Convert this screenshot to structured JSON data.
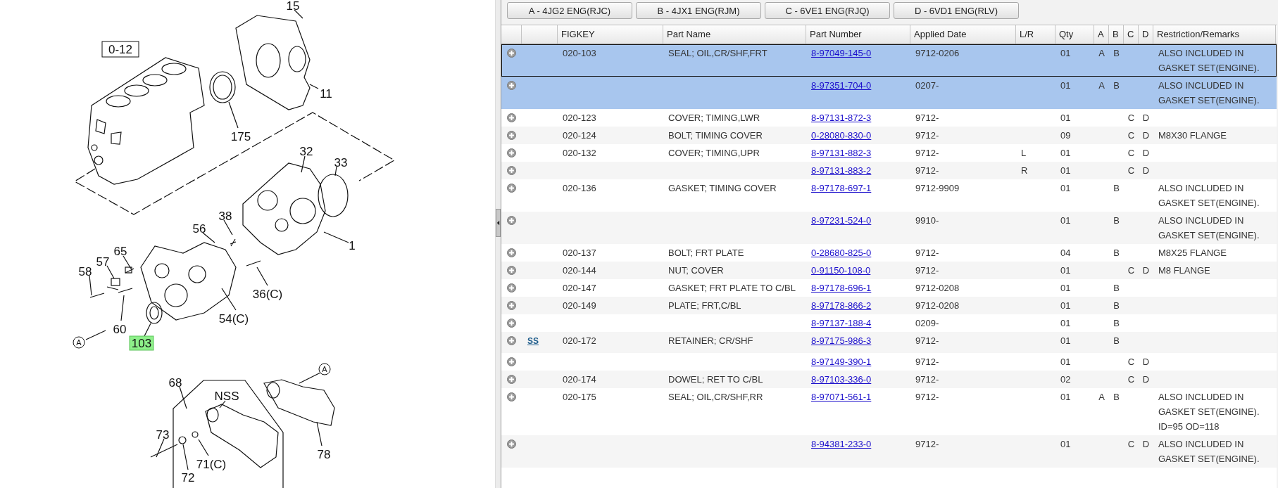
{
  "diagram": {
    "callouts": [
      {
        "text": "15",
        "kind": "plain",
        "highlighted": false
      },
      {
        "text": "0-12",
        "kind": "boxed",
        "highlighted": false
      },
      {
        "text": "11",
        "kind": "plain",
        "highlighted": false
      },
      {
        "text": "175",
        "kind": "plain",
        "highlighted": false
      },
      {
        "text": "32",
        "kind": "plain",
        "highlighted": false
      },
      {
        "text": "33",
        "kind": "plain",
        "highlighted": false
      },
      {
        "text": "38",
        "kind": "plain",
        "highlighted": false
      },
      {
        "text": "56",
        "kind": "plain",
        "highlighted": false
      },
      {
        "text": "1",
        "kind": "plain",
        "highlighted": false
      },
      {
        "text": "65",
        "kind": "plain",
        "highlighted": false
      },
      {
        "text": "57",
        "kind": "plain",
        "highlighted": false
      },
      {
        "text": "58",
        "kind": "plain",
        "highlighted": false
      },
      {
        "text": "36(C)",
        "kind": "plain",
        "highlighted": false
      },
      {
        "text": "54(C)",
        "kind": "plain",
        "highlighted": false
      },
      {
        "text": "60",
        "kind": "plain",
        "highlighted": false
      },
      {
        "text": "103",
        "kind": "plain",
        "highlighted": true
      },
      {
        "text": "A",
        "kind": "circled",
        "highlighted": false
      },
      {
        "text": "68",
        "kind": "plain",
        "highlighted": false
      },
      {
        "text": "NSS",
        "kind": "plain",
        "highlighted": false
      },
      {
        "text": "A",
        "kind": "circled",
        "highlighted": false
      },
      {
        "text": "73",
        "kind": "plain",
        "highlighted": false
      },
      {
        "text": "71(C)",
        "kind": "plain",
        "highlighted": false
      },
      {
        "text": "72",
        "kind": "plain",
        "highlighted": false
      },
      {
        "text": "78",
        "kind": "plain",
        "highlighted": false
      }
    ]
  },
  "engine_buttons": [
    "A - 4JG2 ENG(RJC)",
    "B - 4JX1 ENG(RJM)",
    "C - 6VE1 ENG(RJQ)",
    "D - 6VD1 ENG(RLV)"
  ],
  "table": {
    "columns": [
      {
        "label": "FIGKEY",
        "kind": "text"
      },
      {
        "label": "Part Name",
        "kind": "text"
      },
      {
        "label": "Part Number",
        "kind": "link"
      },
      {
        "label": "Applied Date",
        "kind": "text"
      },
      {
        "label": "L/R",
        "kind": "text"
      },
      {
        "label": "Qty",
        "kind": "text"
      },
      {
        "label": "A",
        "kind": "flag"
      },
      {
        "label": "B",
        "kind": "flag"
      },
      {
        "label": "C",
        "kind": "flag"
      },
      {
        "label": "D",
        "kind": "flag"
      },
      {
        "label": "Restriction/Remarks",
        "kind": "text"
      }
    ],
    "rows": [
      {
        "selected": true,
        "focused": true,
        "figkey": "020-103",
        "part_name": "SEAL; OIL,CR/SHF,FRT",
        "part_number": "8-97049-145-0",
        "applied_date": "9712-0206",
        "qty": "01",
        "a": "A",
        "b": "B",
        "remarks": "ALSO INCLUDED IN GASKET SET(ENGINE)."
      },
      {
        "selected": true,
        "focused": false,
        "part_number": "8-97351-704-0",
        "applied_date": "0207-",
        "qty": "01",
        "a": "A",
        "b": "B",
        "remarks": "ALSO INCLUDED IN GASKET SET(ENGINE)."
      },
      {
        "selected": false,
        "focused": false,
        "figkey": "020-123",
        "part_name": "COVER; TIMING,LWR",
        "part_number": "8-97131-872-3",
        "applied_date": "9712-",
        "qty": "01",
        "c": "C",
        "d": "D"
      },
      {
        "selected": false,
        "focused": false,
        "figkey": "020-124",
        "part_name": "BOLT; TIMING COVER",
        "part_number": "0-28080-830-0",
        "applied_date": "9712-",
        "qty": "09",
        "c": "C",
        "d": "D",
        "remarks": "M8X30 FLANGE"
      },
      {
        "selected": false,
        "focused": false,
        "figkey": "020-132",
        "part_name": "COVER; TIMING,UPR",
        "part_number": "8-97131-882-3",
        "applied_date": "9712-",
        "lr": "L",
        "qty": "01",
        "c": "C",
        "d": "D"
      },
      {
        "selected": false,
        "focused": false,
        "part_number": "8-97131-883-2",
        "applied_date": "9712-",
        "lr": "R",
        "qty": "01",
        "c": "C",
        "d": "D"
      },
      {
        "selected": false,
        "focused": false,
        "figkey": "020-136",
        "part_name": "GASKET; TIMING COVER",
        "part_number": "8-97178-697-1",
        "applied_date": "9712-9909",
        "qty": "01",
        "b": "B",
        "remarks": "ALSO INCLUDED IN GASKET SET(ENGINE)."
      },
      {
        "selected": false,
        "focused": false,
        "part_number": "8-97231-524-0",
        "applied_date": "9910-",
        "qty": "01",
        "b": "B",
        "remarks": "ALSO INCLUDED IN GASKET SET(ENGINE)."
      },
      {
        "selected": false,
        "focused": false,
        "figkey": "020-137",
        "part_name": "BOLT; FRT PLATE",
        "part_number": "0-28680-825-0",
        "applied_date": "9712-",
        "qty": "04",
        "b": "B",
        "remarks": "M8X25 FLANGE"
      },
      {
        "selected": false,
        "focused": false,
        "figkey": "020-144",
        "part_name": "NUT; COVER",
        "part_number": "0-91150-108-0",
        "applied_date": "9712-",
        "qty": "01",
        "c": "C",
        "d": "D",
        "remarks": "M8 FLANGE"
      },
      {
        "selected": false,
        "focused": false,
        "figkey": "020-147",
        "part_name": "GASKET; FRT PLATE TO C/BL",
        "part_number": "8-97178-696-1",
        "applied_date": "9712-0208",
        "qty": "01",
        "b": "B"
      },
      {
        "selected": false,
        "focused": false,
        "figkey": "020-149",
        "part_name": "PLATE; FRT,C/BL",
        "part_number": "8-97178-866-2",
        "applied_date": "9712-0208",
        "qty": "01",
        "b": "B"
      },
      {
        "selected": false,
        "focused": false,
        "part_number": "8-97137-188-4",
        "applied_date": "0209-",
        "qty": "01",
        "b": "B"
      },
      {
        "selected": false,
        "focused": false,
        "ss": "SS",
        "figkey": "020-172",
        "part_name": "RETAINER; CR/SHF",
        "part_number": "8-97175-986-3",
        "applied_date": "9712-",
        "qty": "01",
        "b": "B"
      },
      {
        "selected": false,
        "focused": false,
        "part_number": "8-97149-390-1",
        "applied_date": "9712-",
        "qty": "01",
        "c": "C",
        "d": "D"
      },
      {
        "selected": false,
        "focused": false,
        "figkey": "020-174",
        "part_name": "DOWEL; RET TO C/BL",
        "part_number": "8-97103-336-0",
        "applied_date": "9712-",
        "qty": "02",
        "c": "C",
        "d": "D"
      },
      {
        "selected": false,
        "focused": false,
        "figkey": "020-175",
        "part_name": "SEAL; OIL,CR/SHF,RR",
        "part_number": "8-97071-561-1",
        "applied_date": "9712-",
        "qty": "01",
        "a": "A",
        "b": "B",
        "remarks": "ALSO INCLUDED IN GASKET SET(ENGINE).\nID=95 OD=118"
      },
      {
        "selected": false,
        "focused": false,
        "part_number": "8-94381-233-0",
        "applied_date": "9712-",
        "qty": "01",
        "c": "C",
        "d": "D",
        "remarks": "ALSO INCLUDED IN GASKET SET(ENGINE)."
      }
    ]
  }
}
